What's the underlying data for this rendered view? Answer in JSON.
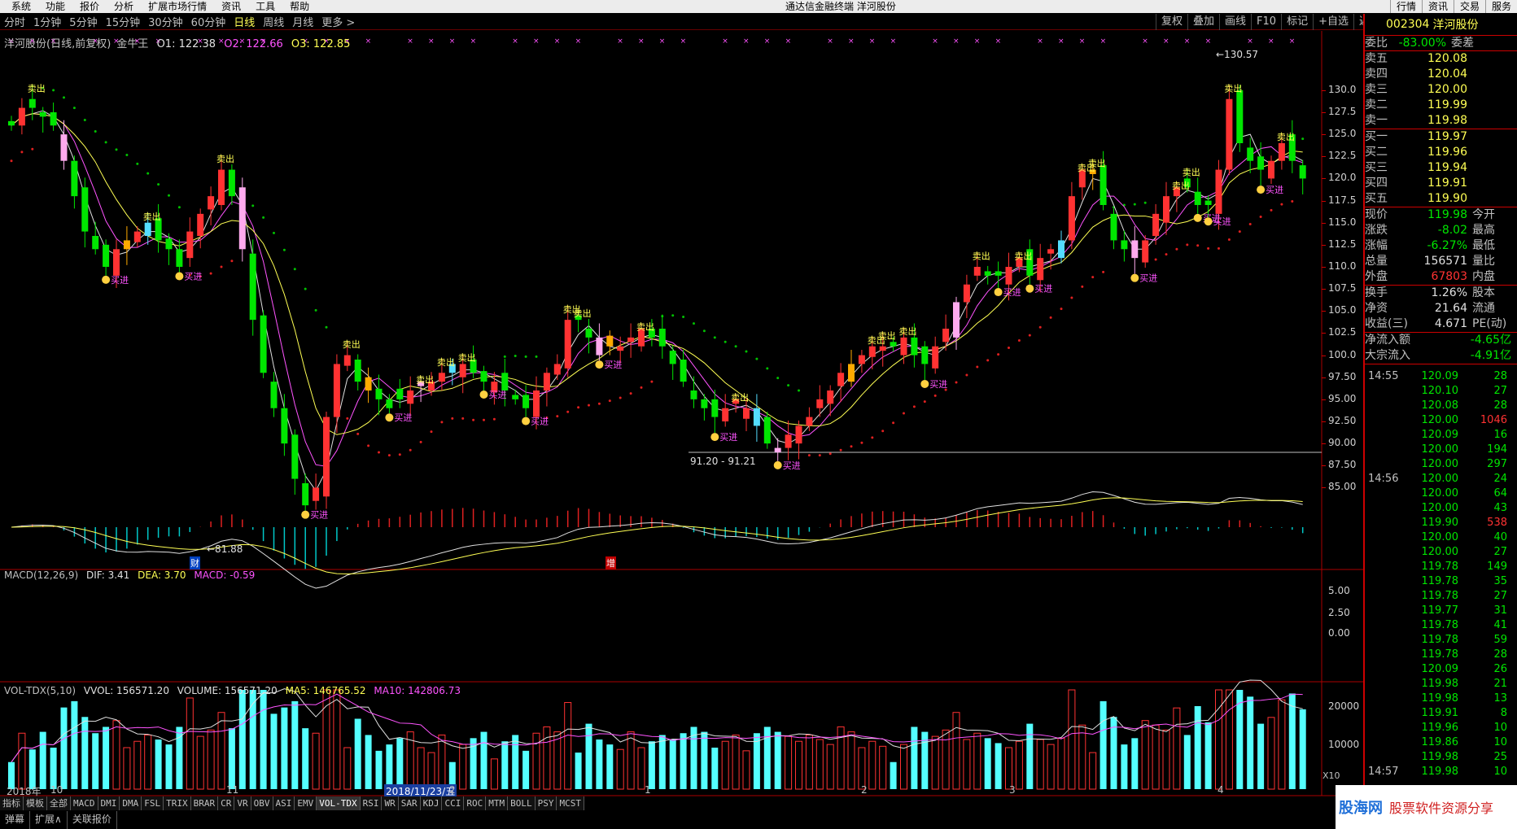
{
  "menu": [
    "系统",
    "功能",
    "报价",
    "分析",
    "扩展市场行情",
    "资讯",
    "工具",
    "帮助"
  ],
  "app_title": "通达信金融终端  洋河股份",
  "right_menu": [
    "行情",
    "资讯",
    "交易",
    "服务"
  ],
  "periods": [
    "分时",
    "1分钟",
    "5分钟",
    "15分钟",
    "30分钟",
    "60分钟",
    "日线",
    "周线",
    "月线",
    "更多 >"
  ],
  "active_period": "日线",
  "tool_buttons": [
    "复权",
    "叠加",
    "画线",
    "F10",
    "标记",
    "+自选",
    "返回"
  ],
  "chart_info": {
    "name": "洋河股份(日线,前复权)",
    "indicator": "金牛王",
    "o1": "O1: 122.38",
    "o2": "O2: 122.66",
    "o3": "O3: 122.85"
  },
  "macd_info": {
    "name": "MACD(12,26,9)",
    "dif": "DIF: 3.41",
    "dea": "DEA: 3.70",
    "macd": "MACD: -0.59"
  },
  "vol_info": {
    "name": "VOL-TDX(5,10)",
    "vvol": "VVOL: 156571.20",
    "volume": "VOLUME: 156571.20",
    "ma5": "MA5: 146765.52",
    "ma10": "MA10: 142806.73"
  },
  "price_axis": [
    "130.0",
    "127.5",
    "125.0",
    "122.5",
    "120.0",
    "117.5",
    "115.0",
    "112.5",
    "110.0",
    "107.5",
    "105.0",
    "102.5",
    "100.0",
    "97.50",
    "95.00",
    "92.50",
    "90.00",
    "87.50",
    "85.00"
  ],
  "macd_axis": [
    "5.00",
    "2.50",
    "0.00"
  ],
  "vol_axis": [
    "20000",
    "10000"
  ],
  "vol_unit": "X10",
  "chart_labels": {
    "low_mark": "←81.88",
    "high_mark": "←130.57",
    "range_mark": "91.20 - 91.21",
    "cai": "财",
    "zeng": "增",
    "buy": "买进",
    "sell": "卖出"
  },
  "x_labels": {
    "y2018": "2018年",
    "m10": "10",
    "m11": "11",
    "cursor_date": "2018/11/23/五",
    "m2a": "2",
    "m1": "1",
    "m2": "2",
    "m3": "3",
    "m4": "4"
  },
  "indicator_tabs": [
    "指标",
    "模板",
    "全部",
    "MACD",
    "DMI",
    "DMA",
    "FSL",
    "TRIX",
    "BRAR",
    "CR",
    "VR",
    "OBV",
    "ASI",
    "EMV",
    "VOL-TDX",
    "RSI",
    "WR",
    "SAR",
    "KDJ",
    "CCI",
    "ROC",
    "MTM",
    "BOLL",
    "PSY",
    "MCST"
  ],
  "active_tab": "VOL-TDX",
  "bottom_tabs": [
    "弹幕",
    "扩展∧",
    "关联报价"
  ],
  "panel": {
    "code": "002304",
    "name": "洋河股份",
    "weibi_label": "委比",
    "weibi": "-83.00%",
    "weicha_label": "委差",
    "sell": [
      {
        "label": "卖五",
        "price": "120.08"
      },
      {
        "label": "卖四",
        "price": "120.04"
      },
      {
        "label": "卖三",
        "price": "120.00"
      },
      {
        "label": "卖二",
        "price": "119.99"
      },
      {
        "label": "卖一",
        "price": "119.98"
      }
    ],
    "buy": [
      {
        "label": "买一",
        "price": "119.97"
      },
      {
        "label": "买二",
        "price": "119.96"
      },
      {
        "label": "买三",
        "price": "119.94"
      },
      {
        "label": "买四",
        "price": "119.91"
      },
      {
        "label": "买五",
        "price": "119.90"
      }
    ],
    "quote": [
      {
        "l1": "现价",
        "v1": "119.98",
        "l2": "今开",
        "c": "green"
      },
      {
        "l1": "涨跌",
        "v1": "-8.02",
        "l2": "最高",
        "c": "green"
      },
      {
        "l1": "涨幅",
        "v1": "-6.27%",
        "l2": "最低",
        "c": "green"
      },
      {
        "l1": "总量",
        "v1": "156571",
        "l2": "量比",
        "c": "white"
      },
      {
        "l1": "外盘",
        "v1": "67803",
        "l2": "内盘",
        "c": "red"
      }
    ],
    "fund": [
      {
        "l1": "换手",
        "v1": "1.26%",
        "l2": "股本"
      },
      {
        "l1": "净资",
        "v1": "21.64",
        "l2": "流通"
      },
      {
        "l1": "收益(三)",
        "v1": "4.671",
        "l2": "PE(动)"
      }
    ],
    "flow": [
      {
        "l1": "净流入额",
        "v1": "-4.65亿"
      },
      {
        "l1": "大宗流入",
        "v1": "-4.91亿"
      }
    ],
    "ticks": [
      {
        "t": "14:55",
        "p": "120.09",
        "v": "28",
        "c": "green"
      },
      {
        "t": "",
        "p": "120.10",
        "v": "27",
        "c": "green"
      },
      {
        "t": "",
        "p": "120.08",
        "v": "28",
        "c": "green"
      },
      {
        "t": "",
        "p": "120.00",
        "v": "1046",
        "c": "red"
      },
      {
        "t": "",
        "p": "120.09",
        "v": "16",
        "c": "green"
      },
      {
        "t": "",
        "p": "120.00",
        "v": "194",
        "c": "green"
      },
      {
        "t": "",
        "p": "120.00",
        "v": "297",
        "c": "green"
      },
      {
        "t": "14:56",
        "p": "120.00",
        "v": "24",
        "c": "green"
      },
      {
        "t": "",
        "p": "120.00",
        "v": "64",
        "c": "green"
      },
      {
        "t": "",
        "p": "120.00",
        "v": "43",
        "c": "green"
      },
      {
        "t": "",
        "p": "119.90",
        "v": "538",
        "c": "red"
      },
      {
        "t": "",
        "p": "120.00",
        "v": "40",
        "c": "green"
      },
      {
        "t": "",
        "p": "120.00",
        "v": "27",
        "c": "green"
      },
      {
        "t": "",
        "p": "119.78",
        "v": "149",
        "c": "green"
      },
      {
        "t": "",
        "p": "119.78",
        "v": "35",
        "c": "green"
      },
      {
        "t": "",
        "p": "119.78",
        "v": "27",
        "c": "green"
      },
      {
        "t": "",
        "p": "119.77",
        "v": "31",
        "c": "green"
      },
      {
        "t": "",
        "p": "119.78",
        "v": "41",
        "c": "green"
      },
      {
        "t": "",
        "p": "119.78",
        "v": "59",
        "c": "green"
      },
      {
        "t": "",
        "p": "119.78",
        "v": "28",
        "c": "green"
      },
      {
        "t": "",
        "p": "120.09",
        "v": "26",
        "c": "green"
      },
      {
        "t": "",
        "p": "119.98",
        "v": "21",
        "c": "green"
      },
      {
        "t": "",
        "p": "119.98",
        "v": "13",
        "c": "green"
      },
      {
        "t": "",
        "p": "119.91",
        "v": "8",
        "c": "green"
      },
      {
        "t": "",
        "p": "119.96",
        "v": "10",
        "c": "green"
      },
      {
        "t": "",
        "p": "119.86",
        "v": "10",
        "c": "green"
      },
      {
        "t": "",
        "p": "119.98",
        "v": "25",
        "c": "green"
      },
      {
        "t": "14:57",
        "p": "119.98",
        "v": "10",
        "c": "green"
      }
    ]
  },
  "watermark": {
    "site": "股海网",
    "slogan": "股票软件资源分享"
  },
  "colors": {
    "up": "#ff3232",
    "down": "#00e600",
    "sell_signal": "#ffff54",
    "buy_signal": "#ff54ff",
    "ma_white": "#e0e0e0",
    "ma_yellow": "#ffff54",
    "ma_pink": "#ff54ff",
    "vol_bar": "#54ffff"
  },
  "chart_data": {
    "type": "candlestick",
    "price_range": [
      82,
      131
    ],
    "close": [
      126,
      128,
      128,
      127,
      126,
      122,
      118,
      114,
      112,
      110,
      112,
      113,
      114,
      115,
      113,
      112,
      110,
      114,
      116,
      118,
      121,
      118,
      112,
      104,
      98,
      94,
      90,
      86,
      83,
      85,
      93,
      99,
      100,
      97,
      96,
      95,
      94,
      95,
      96,
      97,
      97,
      98,
      98,
      99,
      98,
      97,
      97,
      96,
      95,
      94,
      96,
      98,
      99,
      104,
      104,
      102,
      100,
      101,
      101,
      102,
      103,
      102,
      101,
      99,
      97,
      95,
      94,
      93,
      94,
      95,
      94,
      92,
      90,
      89,
      91,
      92,
      93,
      95,
      96,
      98,
      99,
      100,
      101,
      101,
      101,
      102,
      100,
      99,
      101,
      103,
      106,
      108,
      110,
      109,
      109,
      110,
      111,
      109,
      111,
      112,
      113,
      118,
      121,
      121,
      117,
      113,
      112,
      111,
      113,
      116,
      118,
      119,
      119,
      117,
      117,
      121,
      129,
      124,
      122,
      121,
      122,
      124,
      122,
      120
    ]
  }
}
